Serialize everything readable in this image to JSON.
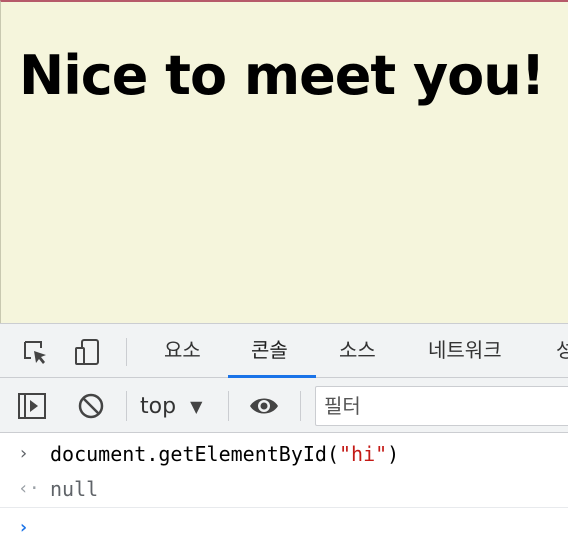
{
  "page": {
    "heading": "Nice to meet you!"
  },
  "devtools": {
    "tabs": [
      "요소",
      "콘솔",
      "소스",
      "네트워크",
      "성"
    ],
    "active_tab": "콘솔",
    "toolbar": {
      "context": "top",
      "context_arrow": "▼",
      "filter_placeholder": "필터"
    },
    "console": {
      "input": {
        "prefix": "›",
        "code_prefix": "document.getElementById(",
        "string_arg": "\"hi\"",
        "code_suffix": ")"
      },
      "output": {
        "prefix": "‹·",
        "value": "null"
      },
      "prompt": {
        "prefix": "›"
      }
    }
  },
  "colors": {
    "page_bg": "#f5f5dc",
    "accent": "#1a73e8",
    "string": "#c41a16"
  }
}
